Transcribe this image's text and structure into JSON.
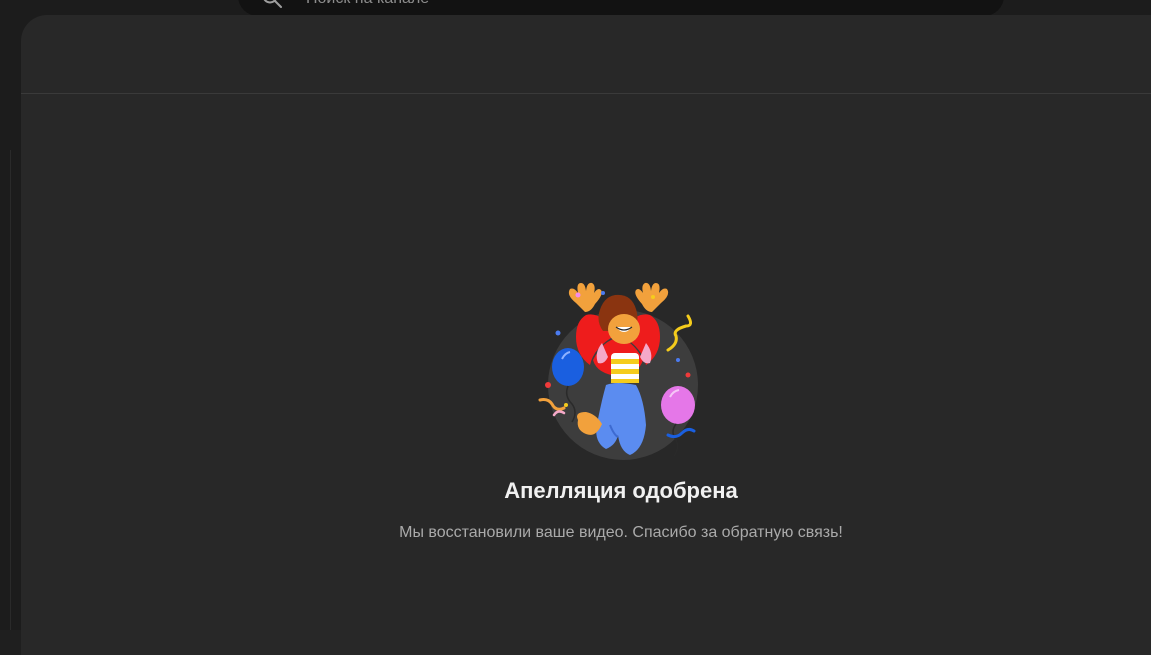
{
  "search": {
    "placeholder": "Поиск на канале"
  },
  "dialog": {
    "title": "Апелляция одобрена",
    "message": "Мы восстановили ваше видео. Спасибо за обратную связь!"
  },
  "icons": {
    "search": "search-icon",
    "illustration": "celebration-illustration"
  }
}
